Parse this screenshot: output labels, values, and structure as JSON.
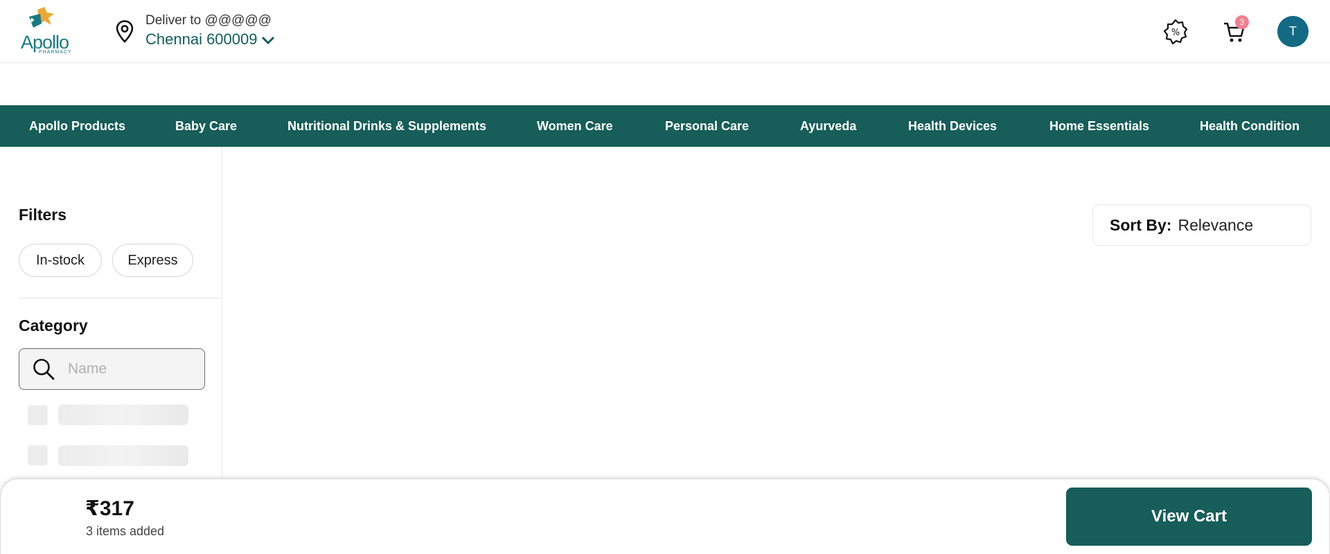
{
  "header": {
    "logo_text": "Apollo",
    "logo_sub": "PHARMACY",
    "deliver_label": "Deliver to @@@@@",
    "location": "Chennai 600009",
    "cart_badge": "3",
    "avatar_initial": "T"
  },
  "nav": {
    "items": [
      "Apollo Products",
      "Baby Care",
      "Nutritional Drinks & Supplements",
      "Women Care",
      "Personal Care",
      "Ayurveda",
      "Health Devices",
      "Home Essentials",
      "Health Condition"
    ]
  },
  "sidebar": {
    "filters_title": "Filters",
    "chips": [
      "In-stock",
      "Express"
    ],
    "category_title": "Category",
    "search_placeholder": "Name"
  },
  "sort": {
    "label": "Sort By:",
    "value": "Relevance"
  },
  "cartbar": {
    "total": "₹317",
    "count": "3 items added",
    "button": "View Cart"
  },
  "colors": {
    "brand": "#175d59",
    "location_text": "#115d5a",
    "badge": "#f07f93",
    "avatar": "#126a85"
  }
}
